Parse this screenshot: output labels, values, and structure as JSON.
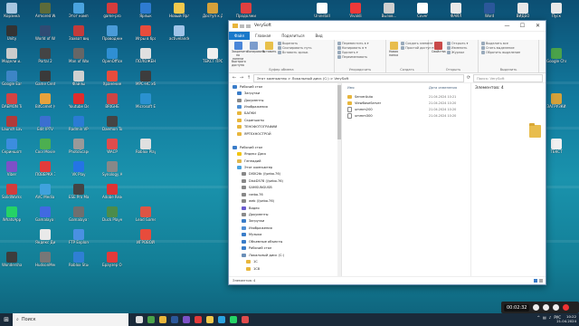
{
  "desktop_icons": [
    {
      "label": "Корзина",
      "icon": "recycle-bin-icon",
      "color": "#a7c6e0",
      "col": 0,
      "row": 0
    },
    {
      "label": "Armored Warfare",
      "icon": "game-icon",
      "color": "#5c6b3a",
      "col": 1,
      "row": 0
    },
    {
      "label": "Этот компьютер",
      "icon": "computer-icon",
      "color": "#4aa3df",
      "col": 2,
      "row": 0
    },
    {
      "label": "game-pro",
      "icon": "game-icon",
      "color": "#d43c3c",
      "col": 3,
      "row": 0
    },
    {
      "label": "Ярлык",
      "icon": "shortcut-icon",
      "color": "#2e7bd1",
      "col": 4,
      "row": 0
    },
    {
      "label": "Новый Ярлык",
      "icon": "shortcut-icon",
      "color": "#f2c94c",
      "col": 5,
      "row": 0
    },
    {
      "label": "Доступ к ДИСКО",
      "icon": "folder-icon",
      "color": "#d4a13a",
      "col": 6,
      "row": 0
    },
    {
      "label": "Продолжить",
      "icon": "app-icon",
      "color": "#e04040",
      "col": 7,
      "row": 0
    },
    {
      "label": "Uninstall",
      "icon": "app-icon",
      "color": "#ffffff",
      "col": 9,
      "row": 0
    },
    {
      "label": "Vivaldi",
      "icon": "browser-icon",
      "color": "#ef3939",
      "col": 10,
      "row": 0
    },
    {
      "label": "Вызов...",
      "icon": "app-icon",
      "color": "#cfcfcf",
      "col": 11,
      "row": 0
    },
    {
      "label": "Cover",
      "icon": "app-icon",
      "color": "#ffffff",
      "col": 12,
      "row": 0
    },
    {
      "label": "ФАЙЛ",
      "icon": "file-icon",
      "color": "#e8e8e8",
      "col": 13,
      "row": 0
    },
    {
      "label": "Word",
      "icon": "word-icon",
      "color": "#2b579a",
      "col": 14,
      "row": 0
    },
    {
      "label": "ВИДЕО",
      "icon": "file-icon",
      "color": "#e8e8e8",
      "col": 15,
      "row": 0
    },
    {
      "label": "Пуск",
      "icon": "app-icon",
      "color": "#e8e8e8",
      "col": 16,
      "row": 0
    },
    {
      "label": "Unity",
      "icon": "unity-icon",
      "color": "#333333",
      "col": 0,
      "row": 1
    },
    {
      "label": "World of Warships",
      "icon": "game-icon",
      "color": "#2f4b73",
      "col": 1,
      "row": 1
    },
    {
      "label": "Захват видео",
      "icon": "app-icon",
      "color": "#c43a3a",
      "col": 2,
      "row": 1
    },
    {
      "label": "Проводник",
      "icon": "app-icon",
      "color": "#4a9bd8",
      "col": 3,
      "row": 1
    },
    {
      "label": "Игры в браузере",
      "icon": "app-icon",
      "color": "#e74c3c",
      "col": 4,
      "row": 1
    },
    {
      "label": "activelander",
      "icon": "app-icon",
      "color": "#a0c4e8",
      "col": 5,
      "row": 1
    },
    {
      "label": "Модели и...",
      "icon": "app-icon",
      "color": "#cccccc",
      "col": 0,
      "row": 2
    },
    {
      "label": "Portal 2",
      "icon": "game-icon",
      "color": "#444444",
      "col": 1,
      "row": 2
    },
    {
      "label": "Man of War",
      "icon": "game-icon",
      "color": "#666666",
      "col": 2,
      "row": 2
    },
    {
      "label": "OpenOffice 4.1.15",
      "icon": "app-icon",
      "color": "#2f8fd3",
      "col": 3,
      "row": 2
    },
    {
      "label": "ПОЛОЖЕНИЕ",
      "icon": "file-icon",
      "color": "#e0e0e0",
      "col": 4,
      "row": 2
    },
    {
      "label": "ТЕКСТ ПРОВЕРКИ",
      "icon": "file-icon",
      "color": "#f0f0f0",
      "col": 6,
      "row": 2
    },
    {
      "label": "Google Earth Pro",
      "icon": "earth-icon",
      "color": "#3d85c6",
      "col": 0,
      "row": 3
    },
    {
      "label": "Game Center",
      "icon": "app-icon",
      "color": "#3a3a3a",
      "col": 1,
      "row": 3
    },
    {
      "label": "Файлы",
      "icon": "file-icon",
      "color": "#d0d0d0",
      "col": 2,
      "row": 3
    },
    {
      "label": "Хранение",
      "icon": "app-icon",
      "color": "#e74c3c",
      "col": 3,
      "row": 3
    },
    {
      "label": "MPC-HC x64",
      "icon": "media-icon",
      "color": "#3d3d3d",
      "col": 4,
      "row": 3
    },
    {
      "label": "DAEMON Tools Lite",
      "icon": "app-icon",
      "color": "#d34343",
      "col": 0,
      "row": 4
    },
    {
      "label": "BitComet (64-bit)",
      "icon": "app-icon",
      "color": "#e6a23c",
      "col": 1,
      "row": 4
    },
    {
      "label": "Youtube Desktop",
      "icon": "app-icon",
      "color": "#e02c2c",
      "col": 2,
      "row": 4
    },
    {
      "label": "BRIGHE",
      "icon": "app-icon",
      "color": "#c44",
      "col": 3,
      "row": 4
    },
    {
      "label": "Microsoft Edge",
      "icon": "edge-icon",
      "color": "#2a91d0",
      "col": 4,
      "row": 4
    },
    {
      "label": "Launch Lavos",
      "icon": "app-icon",
      "color": "#b03a3a",
      "col": 0,
      "row": 5
    },
    {
      "label": "Edit IPTV",
      "icon": "app-icon",
      "color": "#3b6fd0",
      "col": 1,
      "row": 5
    },
    {
      "label": "Radmin VPN",
      "icon": "app-icon",
      "color": "#2a7bd4",
      "col": 2,
      "row": 5
    },
    {
      "label": "Daemon Tools",
      "icon": "app-icon",
      "color": "#444",
      "col": 3,
      "row": 5
    },
    {
      "label": "Скриншоты",
      "icon": "app-icon",
      "color": "#3c8dde",
      "col": 0,
      "row": 6
    },
    {
      "label": "Cool Movies",
      "icon": "app-icon",
      "color": "#4caf50",
      "col": 1,
      "row": 6
    },
    {
      "label": "PhotoScape",
      "icon": "app-icon",
      "color": "#999",
      "col": 2,
      "row": 6
    },
    {
      "label": "WACP",
      "icon": "app-icon",
      "color": "#e04c4c",
      "col": 3,
      "row": 6
    },
    {
      "label": "Roblox Player",
      "icon": "app-icon",
      "color": "#e0e0e0",
      "col": 4,
      "row": 6
    },
    {
      "label": "Viber",
      "icon": "viber-icon",
      "color": "#7d51c7",
      "col": 0,
      "row": 7
    },
    {
      "label": "ПОВЕРКА ЗАДАЧ",
      "icon": "app-icon",
      "color": "#e23b3b",
      "col": 1,
      "row": 7
    },
    {
      "label": "VK Play",
      "icon": "app-icon",
      "color": "#2474e5",
      "col": 2,
      "row": 7
    },
    {
      "label": "Synology Assistant",
      "icon": "app-icon",
      "color": "#888",
      "col": 3,
      "row": 7
    },
    {
      "label": "SolidWorks Viewer",
      "icon": "app-icon",
      "color": "#d23c3c",
      "col": 0,
      "row": 8
    },
    {
      "label": "AVC Media Player",
      "icon": "app-icon",
      "color": "#3fa2dd",
      "col": 1,
      "row": 8
    },
    {
      "label": "ESE Pro Manager",
      "icon": "app-icon",
      "color": "#444",
      "col": 2,
      "row": 8
    },
    {
      "label": "Adobe Reader",
      "icon": "app-icon",
      "color": "#d33",
      "col": 3,
      "row": 8
    },
    {
      "label": "WhatsApp",
      "icon": "whatsapp-icon",
      "color": "#25d366",
      "col": 0,
      "row": 9
    },
    {
      "label": "Gamalaya Player",
      "icon": "app-icon",
      "color": "#4169e1",
      "col": 1,
      "row": 9
    },
    {
      "label": "Gamalaya Settings",
      "icon": "app-icon",
      "color": "#6f6f6f",
      "col": 2,
      "row": 9
    },
    {
      "label": "Duck Player",
      "icon": "app-icon",
      "color": "#4b8c4b",
      "col": 3,
      "row": 9
    },
    {
      "label": "Lead Game Center",
      "icon": "app-icon",
      "color": "#d54",
      "col": 4,
      "row": 9
    },
    {
      "label": "Яндекс Диск",
      "icon": "app-icon",
      "color": "#e9e9e9",
      "col": 1,
      "row": 10
    },
    {
      "label": "FTP Explorer",
      "icon": "app-icon",
      "color": "#4a90e2",
      "col": 2,
      "row": 10
    },
    {
      "label": "ИГРОВОЙ",
      "icon": "app-icon",
      "color": "#e74c3c",
      "col": 4,
      "row": 10
    },
    {
      "label": "Wondershare Filmora 12",
      "icon": "app-icon",
      "color": "#3d3d3d",
      "col": 0,
      "row": 11
    },
    {
      "label": "HudsonMedia",
      "icon": "app-icon",
      "color": "#777",
      "col": 1,
      "row": 11
    },
    {
      "label": "Roblox Studio",
      "icon": "app-icon",
      "color": "#2f7fd4",
      "col": 2,
      "row": 11
    },
    {
      "label": "Браузер Opera",
      "icon": "opera-icon",
      "color": "#e23a3a",
      "col": 3,
      "row": 11
    },
    {
      "label": "Google Chrome",
      "icon": "chrome-icon",
      "color": "#4aa24a",
      "col": 16,
      "row": 2
    },
    {
      "label": "ЗАГРУЗКИ",
      "icon": "folder-icon",
      "color": "#d4a13a",
      "col": 16,
      "row": 4
    },
    {
      "label": "ТЕКСТ",
      "icon": "file-icon",
      "color": "#f0f0f0",
      "col": 16,
      "row": 6
    }
  ],
  "window": {
    "title": "VerySoft",
    "controls": {
      "minimize": "—",
      "maximize": "☐",
      "close": "✕"
    },
    "tabs": [
      "Файл",
      "Главная",
      "Поделиться",
      "Вид"
    ],
    "ribbon": {
      "groups": [
        {
          "name": "Буфер обмена",
          "big": [
            {
              "label": "Закрепить на панели быстрого доступа",
              "color": "#4a86d8"
            },
            {
              "label": "Копировать",
              "color": "#7c9ccc"
            },
            {
              "label": "Вставить",
              "color": "#e8c04a"
            }
          ],
          "small": [
            "Вырезать",
            "Скопировать путь",
            "Вставить ярлык"
          ]
        },
        {
          "name": "Упорядочить",
          "big": [],
          "small": [
            "Переместить в ▾",
            "Копировать в ▾",
            "Удалить ▾",
            "Переименовать"
          ]
        },
        {
          "name": "Создать",
          "big": [
            {
              "label": "Новая папка",
              "color": "#e8bd4d"
            }
          ],
          "small": [
            "Создать элемент ▾",
            "Простой доступ ▾"
          ]
        },
        {
          "name": "Открыть",
          "big": [
            {
              "label": "Свойства",
              "color": "#c94a4a"
            }
          ],
          "small": [
            "Открыть ▾",
            "Изменить",
            "Журнал"
          ]
        },
        {
          "name": "Выделить",
          "big": [],
          "small": [
            "Выделить все",
            "Снять выделение",
            "Обратить выделение"
          ]
        }
      ]
    },
    "address": {
      "path": "Этот компьютер  >  Локальный диск (C:)  >  VerySoft",
      "search_placeholder": "Поиск: VerySoft"
    },
    "nav": [
      {
        "label": "Рабочий стол",
        "icon": "desktop-icon",
        "color": "#3a7dc9",
        "indent": 0
      },
      {
        "label": "Загрузки",
        "icon": "download-icon",
        "color": "#3a7dc9",
        "indent": 1
      },
      {
        "label": "Документы",
        "icon": "document-icon",
        "color": "#8a8a8a",
        "indent": 1
      },
      {
        "label": "Изображения",
        "icon": "image-icon",
        "color": "#4f8fd4",
        "indent": 1
      },
      {
        "label": "БАЛКИ",
        "icon": "folder-icon",
        "color": "#e8b63c",
        "indent": 1
      },
      {
        "label": "Скриншоты",
        "icon": "folder-icon",
        "color": "#e8b63c",
        "indent": 1
      },
      {
        "label": "ТЕНОФОТОГРАФИИ",
        "icon": "folder-icon",
        "color": "#e8b63c",
        "indent": 1
      },
      {
        "label": "ЯРТЕХНОСТРОЙ",
        "icon": "folder-icon",
        "color": "#e8b63c",
        "indent": 1
      },
      {
        "label": "",
        "icon": "",
        "color": "transparent",
        "indent": 0
      },
      {
        "label": "Рабочий стол",
        "icon": "desktop-icon",
        "color": "#3a7dc9",
        "indent": 0
      },
      {
        "label": "Яндекс Диск",
        "icon": "cloud-icon",
        "color": "#f1c40f",
        "indent": 1
      },
      {
        "label": "Геннадий",
        "icon": "user-icon",
        "color": "#e0b74b",
        "indent": 1
      },
      {
        "label": "Этот компьютер",
        "icon": "computer-icon",
        "color": "#4aa3df",
        "indent": 1
      },
      {
        "label": "DISK2tb (\\\\sebo.76)",
        "icon": "drive-icon",
        "color": "#888",
        "indent": 2
      },
      {
        "label": "DiskD578 (\\\\sebo.76)",
        "icon": "drive-icon",
        "color": "#888",
        "indent": 2
      },
      {
        "label": "SAMSUNGUSB",
        "icon": "drive-icon",
        "color": "#888",
        "indent": 2
      },
      {
        "label": "rzebo.76",
        "icon": "drive-icon",
        "color": "#888",
        "indent": 2
      },
      {
        "label": "web (\\\\sebo.76)",
        "icon": "drive-icon",
        "color": "#888",
        "indent": 2
      },
      {
        "label": "Видео",
        "icon": "video-icon",
        "color": "#6a5acd",
        "indent": 2
      },
      {
        "label": "Документы",
        "icon": "document-icon",
        "color": "#8a8a8a",
        "indent": 2
      },
      {
        "label": "Загрузки",
        "icon": "download-icon",
        "color": "#3a7dc9",
        "indent": 2
      },
      {
        "label": "Изображения",
        "icon": "image-icon",
        "color": "#4f8fd4",
        "indent": 2
      },
      {
        "label": "Музыка",
        "icon": "music-icon",
        "color": "#3a7dc9",
        "indent": 2
      },
      {
        "label": "Объемные объекты",
        "icon": "cube-icon",
        "color": "#3a7dc9",
        "indent": 2
      },
      {
        "label": "Рабочий стол",
        "icon": "desktop-icon",
        "color": "#3a7dc9",
        "indent": 2
      },
      {
        "label": "Локальный диск (C:)",
        "icon": "drive-icon",
        "color": "#6a8fb8",
        "indent": 2
      },
      {
        "label": "1C",
        "icon": "folder-icon",
        "color": "#e8b63c",
        "indent": 3
      },
      {
        "label": "1C8",
        "icon": "folder-icon",
        "color": "#e8b63c",
        "indent": 3
      }
    ],
    "columns": {
      "name": "Имя",
      "date": "Дата изменения"
    },
    "files": [
      {
        "name": "ServerAuto",
        "date": "21.04.2024 10:21",
        "type": "folder"
      },
      {
        "name": "ViewBaseServer",
        "date": "21.04.2024 10:20",
        "type": "folder"
      },
      {
        "name": "ummm200",
        "date": "21.04.2024 10:20",
        "type": "file"
      },
      {
        "name": "ummm300",
        "date": "21.04.2024 10:20",
        "type": "file"
      }
    ],
    "preview_count": "Элементов: 4",
    "status": "Элементов: 4"
  },
  "taskbar": {
    "search_placeholder": "Поиск",
    "apps": [
      {
        "name": "task-view-icon",
        "color": "#e0e0e0"
      },
      {
        "name": "chrome-icon",
        "color": "#4aa24a"
      },
      {
        "name": "explorer-icon",
        "color": "#e8b63c"
      },
      {
        "name": "word-icon",
        "color": "#2b579a"
      },
      {
        "name": "viber-icon",
        "color": "#7d51c7"
      },
      {
        "name": "opera-icon",
        "color": "#e23a3a"
      },
      {
        "name": "yandex-icon",
        "color": "#f2c94c"
      },
      {
        "name": "telegram-icon",
        "color": "#2aa3e0"
      },
      {
        "name": "whatsapp-icon",
        "color": "#25d366"
      },
      {
        "name": "media-icon",
        "color": "#e04c4c"
      }
    ],
    "language": "РУС",
    "time": "10:22",
    "date": "21.04.2024"
  },
  "recorder": {
    "time": "00:02:32"
  }
}
